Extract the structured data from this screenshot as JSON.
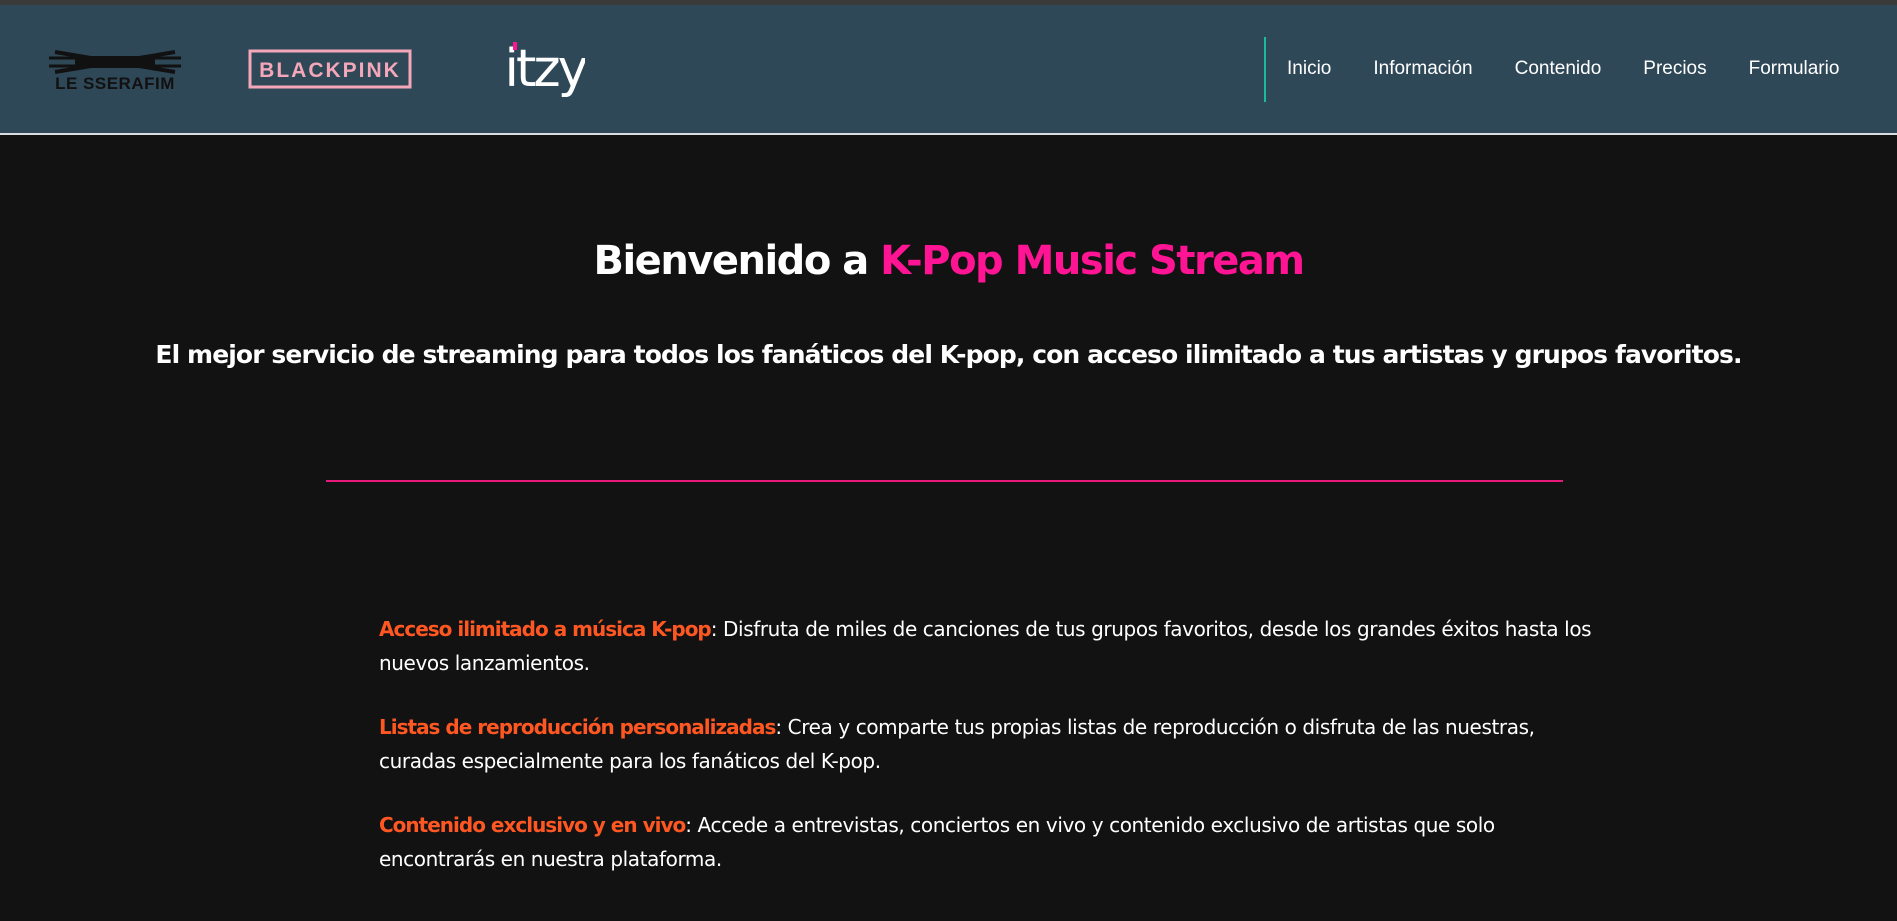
{
  "logos": {
    "lesserafim": "LE SSERAFIM",
    "blackpink": "BLACKPINK",
    "itzy": "itzy"
  },
  "nav": {
    "items": [
      "Inicio",
      "Información",
      "Contenido",
      "Precios",
      "Formulario"
    ]
  },
  "hero": {
    "title_prefix": "Bienvenido a ",
    "title_accent": "K-Pop Music Stream",
    "subtitle": "El mejor servicio de streaming para todos los fanáticos del K-pop, con acceso ilimitado a tus artistas y grupos favoritos."
  },
  "features": [
    {
      "label": "Acceso ilimitado a música K-pop",
      "text": ": Disfruta de miles de canciones de tus grupos favoritos, desde los grandes éxitos hasta los nuevos lanzamientos."
    },
    {
      "label": "Listas de reproducción personalizadas",
      "text": ": Crea y comparte tus propias listas de reproducción o disfruta de las nuestras, curadas especialmente para los fanáticos del K-pop."
    },
    {
      "label": "Contenido exclusivo y en vivo",
      "text": ": Accede a entrevistas, conciertos en vivo y contenido exclusivo de artistas que solo encontrarás en nuestra plataforma."
    }
  ],
  "colors": {
    "header_bg": "#2f4858",
    "page_bg": "#121212",
    "accent_pink": "#ff1493",
    "feature_orange": "#ff5722",
    "nav_divider": "#1abc9c",
    "blackpink_pink": "#f4a7b9"
  }
}
